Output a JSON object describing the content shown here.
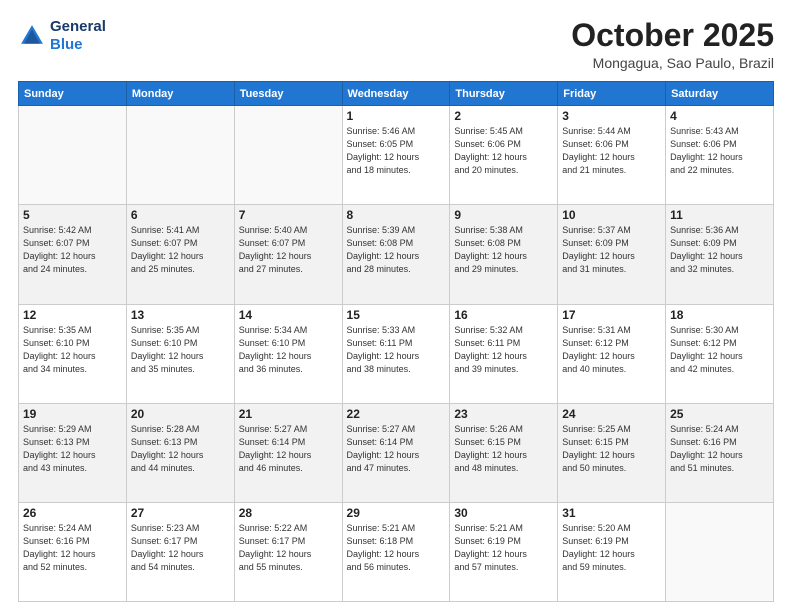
{
  "header": {
    "logo_line1": "General",
    "logo_line2": "Blue",
    "month": "October 2025",
    "location": "Mongagua, Sao Paulo, Brazil"
  },
  "weekdays": [
    "Sunday",
    "Monday",
    "Tuesday",
    "Wednesday",
    "Thursday",
    "Friday",
    "Saturday"
  ],
  "weeks": [
    [
      {
        "day": "",
        "info": ""
      },
      {
        "day": "",
        "info": ""
      },
      {
        "day": "",
        "info": ""
      },
      {
        "day": "1",
        "info": "Sunrise: 5:46 AM\nSunset: 6:05 PM\nDaylight: 12 hours\nand 18 minutes."
      },
      {
        "day": "2",
        "info": "Sunrise: 5:45 AM\nSunset: 6:06 PM\nDaylight: 12 hours\nand 20 minutes."
      },
      {
        "day": "3",
        "info": "Sunrise: 5:44 AM\nSunset: 6:06 PM\nDaylight: 12 hours\nand 21 minutes."
      },
      {
        "day": "4",
        "info": "Sunrise: 5:43 AM\nSunset: 6:06 PM\nDaylight: 12 hours\nand 22 minutes."
      }
    ],
    [
      {
        "day": "5",
        "info": "Sunrise: 5:42 AM\nSunset: 6:07 PM\nDaylight: 12 hours\nand 24 minutes."
      },
      {
        "day": "6",
        "info": "Sunrise: 5:41 AM\nSunset: 6:07 PM\nDaylight: 12 hours\nand 25 minutes."
      },
      {
        "day": "7",
        "info": "Sunrise: 5:40 AM\nSunset: 6:07 PM\nDaylight: 12 hours\nand 27 minutes."
      },
      {
        "day": "8",
        "info": "Sunrise: 5:39 AM\nSunset: 6:08 PM\nDaylight: 12 hours\nand 28 minutes."
      },
      {
        "day": "9",
        "info": "Sunrise: 5:38 AM\nSunset: 6:08 PM\nDaylight: 12 hours\nand 29 minutes."
      },
      {
        "day": "10",
        "info": "Sunrise: 5:37 AM\nSunset: 6:09 PM\nDaylight: 12 hours\nand 31 minutes."
      },
      {
        "day": "11",
        "info": "Sunrise: 5:36 AM\nSunset: 6:09 PM\nDaylight: 12 hours\nand 32 minutes."
      }
    ],
    [
      {
        "day": "12",
        "info": "Sunrise: 5:35 AM\nSunset: 6:10 PM\nDaylight: 12 hours\nand 34 minutes."
      },
      {
        "day": "13",
        "info": "Sunrise: 5:35 AM\nSunset: 6:10 PM\nDaylight: 12 hours\nand 35 minutes."
      },
      {
        "day": "14",
        "info": "Sunrise: 5:34 AM\nSunset: 6:10 PM\nDaylight: 12 hours\nand 36 minutes."
      },
      {
        "day": "15",
        "info": "Sunrise: 5:33 AM\nSunset: 6:11 PM\nDaylight: 12 hours\nand 38 minutes."
      },
      {
        "day": "16",
        "info": "Sunrise: 5:32 AM\nSunset: 6:11 PM\nDaylight: 12 hours\nand 39 minutes."
      },
      {
        "day": "17",
        "info": "Sunrise: 5:31 AM\nSunset: 6:12 PM\nDaylight: 12 hours\nand 40 minutes."
      },
      {
        "day": "18",
        "info": "Sunrise: 5:30 AM\nSunset: 6:12 PM\nDaylight: 12 hours\nand 42 minutes."
      }
    ],
    [
      {
        "day": "19",
        "info": "Sunrise: 5:29 AM\nSunset: 6:13 PM\nDaylight: 12 hours\nand 43 minutes."
      },
      {
        "day": "20",
        "info": "Sunrise: 5:28 AM\nSunset: 6:13 PM\nDaylight: 12 hours\nand 44 minutes."
      },
      {
        "day": "21",
        "info": "Sunrise: 5:27 AM\nSunset: 6:14 PM\nDaylight: 12 hours\nand 46 minutes."
      },
      {
        "day": "22",
        "info": "Sunrise: 5:27 AM\nSunset: 6:14 PM\nDaylight: 12 hours\nand 47 minutes."
      },
      {
        "day": "23",
        "info": "Sunrise: 5:26 AM\nSunset: 6:15 PM\nDaylight: 12 hours\nand 48 minutes."
      },
      {
        "day": "24",
        "info": "Sunrise: 5:25 AM\nSunset: 6:15 PM\nDaylight: 12 hours\nand 50 minutes."
      },
      {
        "day": "25",
        "info": "Sunrise: 5:24 AM\nSunset: 6:16 PM\nDaylight: 12 hours\nand 51 minutes."
      }
    ],
    [
      {
        "day": "26",
        "info": "Sunrise: 5:24 AM\nSunset: 6:16 PM\nDaylight: 12 hours\nand 52 minutes."
      },
      {
        "day": "27",
        "info": "Sunrise: 5:23 AM\nSunset: 6:17 PM\nDaylight: 12 hours\nand 54 minutes."
      },
      {
        "day": "28",
        "info": "Sunrise: 5:22 AM\nSunset: 6:17 PM\nDaylight: 12 hours\nand 55 minutes."
      },
      {
        "day": "29",
        "info": "Sunrise: 5:21 AM\nSunset: 6:18 PM\nDaylight: 12 hours\nand 56 minutes."
      },
      {
        "day": "30",
        "info": "Sunrise: 5:21 AM\nSunset: 6:19 PM\nDaylight: 12 hours\nand 57 minutes."
      },
      {
        "day": "31",
        "info": "Sunrise: 5:20 AM\nSunset: 6:19 PM\nDaylight: 12 hours\nand 59 minutes."
      },
      {
        "day": "",
        "info": ""
      }
    ]
  ]
}
